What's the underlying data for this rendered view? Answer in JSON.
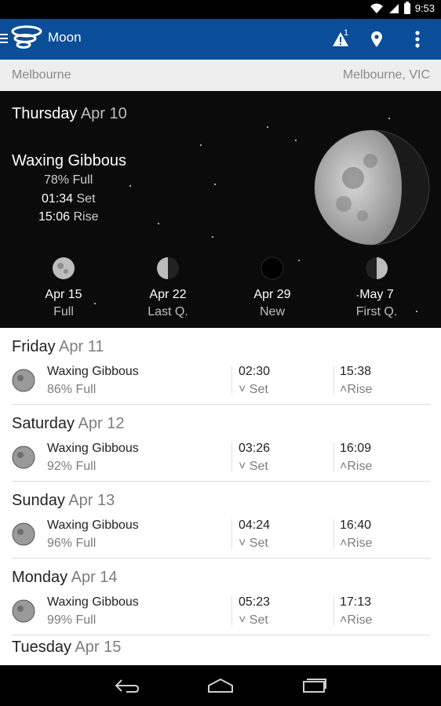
{
  "status": {
    "time": "9:53"
  },
  "app": {
    "title": "Moon",
    "alerts_count": "1"
  },
  "location": {
    "left": "Melbourne",
    "right": "Melbourne, VIC"
  },
  "hero": {
    "weekday": "Thursday",
    "date": "Apr 10",
    "phase": "Waxing Gibbous",
    "percent": "78% Full",
    "set_time": "01:34",
    "set_label": "Set",
    "rise_time": "15:06",
    "rise_label": "Rise",
    "upcoming": [
      {
        "date": "Apr 15",
        "label": "Full",
        "icon": "full-moon-icon"
      },
      {
        "date": "Apr 22",
        "label": "Last Q.",
        "icon": "last-quarter-moon-icon"
      },
      {
        "date": "Apr 29",
        "label": "New",
        "icon": "new-moon-icon"
      },
      {
        "date": "May 7",
        "label": "First Q.",
        "icon": "first-quarter-moon-icon"
      }
    ]
  },
  "days": [
    {
      "weekday": "Friday",
      "date": "Apr 11",
      "phase": "Waxing Gibbous",
      "percent": "86% Full",
      "set": "02:30",
      "set_label": "Set",
      "rise": "15:38",
      "rise_label": "Rise"
    },
    {
      "weekday": "Saturday",
      "date": "Apr 12",
      "phase": "Waxing Gibbous",
      "percent": "92% Full",
      "set": "03:26",
      "set_label": "Set",
      "rise": "16:09",
      "rise_label": "Rise"
    },
    {
      "weekday": "Sunday",
      "date": "Apr 13",
      "phase": "Waxing Gibbous",
      "percent": "96% Full",
      "set": "04:24",
      "set_label": "Set",
      "rise": "16:40",
      "rise_label": "Rise"
    },
    {
      "weekday": "Monday",
      "date": "Apr 14",
      "phase": "Waxing Gibbous",
      "percent": "99% Full",
      "set": "05:23",
      "set_label": "Set",
      "rise": "17:13",
      "rise_label": "Rise"
    },
    {
      "weekday": "Tuesday",
      "date": "Apr 15"
    }
  ],
  "colors": {
    "appbar": "#0a4d98",
    "location_bar": "#eeeeee",
    "hero_bg": "#0b0b0b"
  },
  "icons": {
    "status": [
      "wifi-icon",
      "signal-icon",
      "battery-icon"
    ],
    "appbar": [
      "menu-icon",
      "app-logo-icon",
      "warning-icon",
      "location-pin-icon",
      "overflow-menu-icon"
    ],
    "navbar": [
      "back-icon",
      "home-icon",
      "recents-icon"
    ]
  }
}
